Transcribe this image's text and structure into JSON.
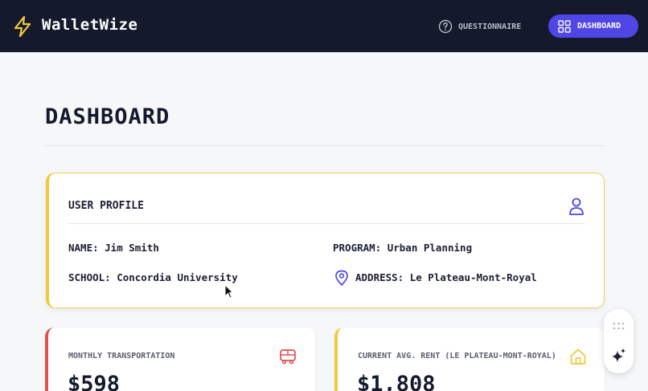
{
  "header": {
    "brand": "WalletWize",
    "nav": {
      "questionnaire": "QUESTIONNAIRE",
      "dashboard": "DASHBOARD"
    }
  },
  "page": {
    "title": "DASHBOARD"
  },
  "profile": {
    "title": "USER PROFILE",
    "name": "NAME: Jim Smith",
    "program": "PROGRAM: Urban Planning",
    "school": "SCHOOL: Concordia University",
    "address": "ADDRESS: Le Plateau-Mont-Royal"
  },
  "stats": [
    {
      "label": "MONTHLY TRANSPORTATION",
      "value": "$598",
      "icon": "bus-icon",
      "accent": "#e0524a"
    },
    {
      "label": "CURRENT AVG. RENT (LE PLATEAU-MONT-ROYAL)",
      "value": "$1,808",
      "icon": "home-icon",
      "accent": "#f0c93e"
    }
  ],
  "colors": {
    "navbar": "#141a2c",
    "accent": "#4f46e5",
    "profile_border": "#f0c93e"
  }
}
